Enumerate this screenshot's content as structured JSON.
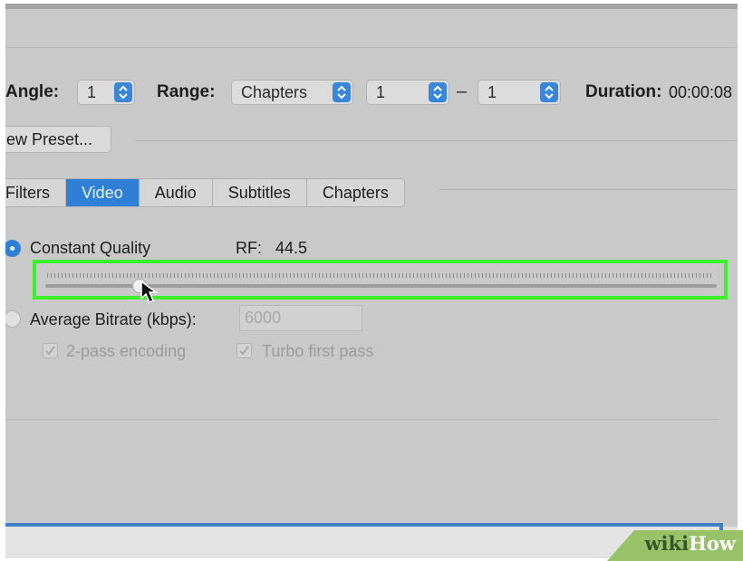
{
  "toolbar": {
    "angle_label": "Angle:",
    "angle_value": "1",
    "range_label": "Range:",
    "range_type": "Chapters",
    "range_start": "1",
    "range_separator": "–",
    "range_end": "1",
    "duration_label": "Duration:",
    "duration_value": "00:00:08"
  },
  "preset": {
    "new_preset_label": "ew Preset..."
  },
  "tabs": [
    {
      "label": "Filters",
      "selected": false
    },
    {
      "label": "Video",
      "selected": true
    },
    {
      "label": "Audio",
      "selected": false
    },
    {
      "label": "Subtitles",
      "selected": false
    },
    {
      "label": "Chapters",
      "selected": false
    }
  ],
  "quality": {
    "constant_quality_label": "Constant Quality",
    "rf_label": "RF:",
    "rf_value": "44.5",
    "slider_position_fraction": 0.14,
    "highlight_color": "#3ef028",
    "average_bitrate_label": "Average Bitrate (kbps):",
    "bitrate_placeholder": "6000",
    "two_pass_label": "2-pass encoding",
    "turbo_label": "Turbo first pass"
  },
  "watermark": {
    "part1": "wiki",
    "part2": "How"
  },
  "colors": {
    "accent": "#2f7fd6",
    "panel": "#c9c9c9"
  }
}
